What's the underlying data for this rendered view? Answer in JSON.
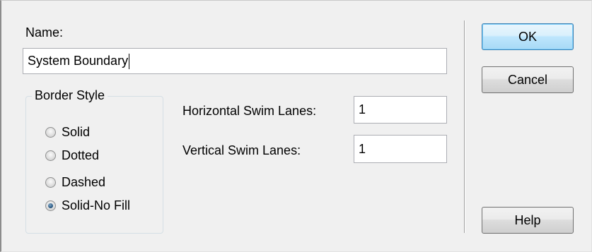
{
  "dialog": {
    "name_label": "Name:",
    "name_value": "System Boundary",
    "border_style": {
      "legend": "Border Style",
      "options": [
        {
          "label": "Solid",
          "selected": false
        },
        {
          "label": "Dotted",
          "selected": false
        },
        {
          "label": "Dashed",
          "selected": false
        },
        {
          "label": "Solid-No Fill",
          "selected": true
        }
      ]
    },
    "horizontal_swim_lanes": {
      "label": "Horizontal Swim Lanes:",
      "value": "1"
    },
    "vertical_swim_lanes": {
      "label": "Vertical Swim Lanes:",
      "value": "1"
    },
    "buttons": {
      "ok": "OK",
      "cancel": "Cancel",
      "help": "Help"
    }
  }
}
